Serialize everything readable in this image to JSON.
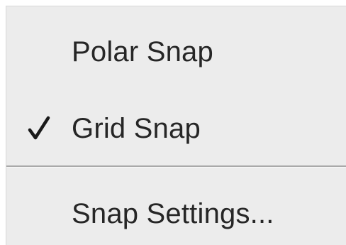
{
  "menu": {
    "items": [
      {
        "label": "Polar Snap",
        "checked": false
      },
      {
        "label": "Grid Snap",
        "checked": true,
        "check_icon": "checkmark-icon"
      },
      {
        "label": "Snap Settings...",
        "checked": false
      }
    ]
  },
  "colors": {
    "menu_background": "#ececec",
    "text": "#262626",
    "separator": "#a9a9a9"
  }
}
